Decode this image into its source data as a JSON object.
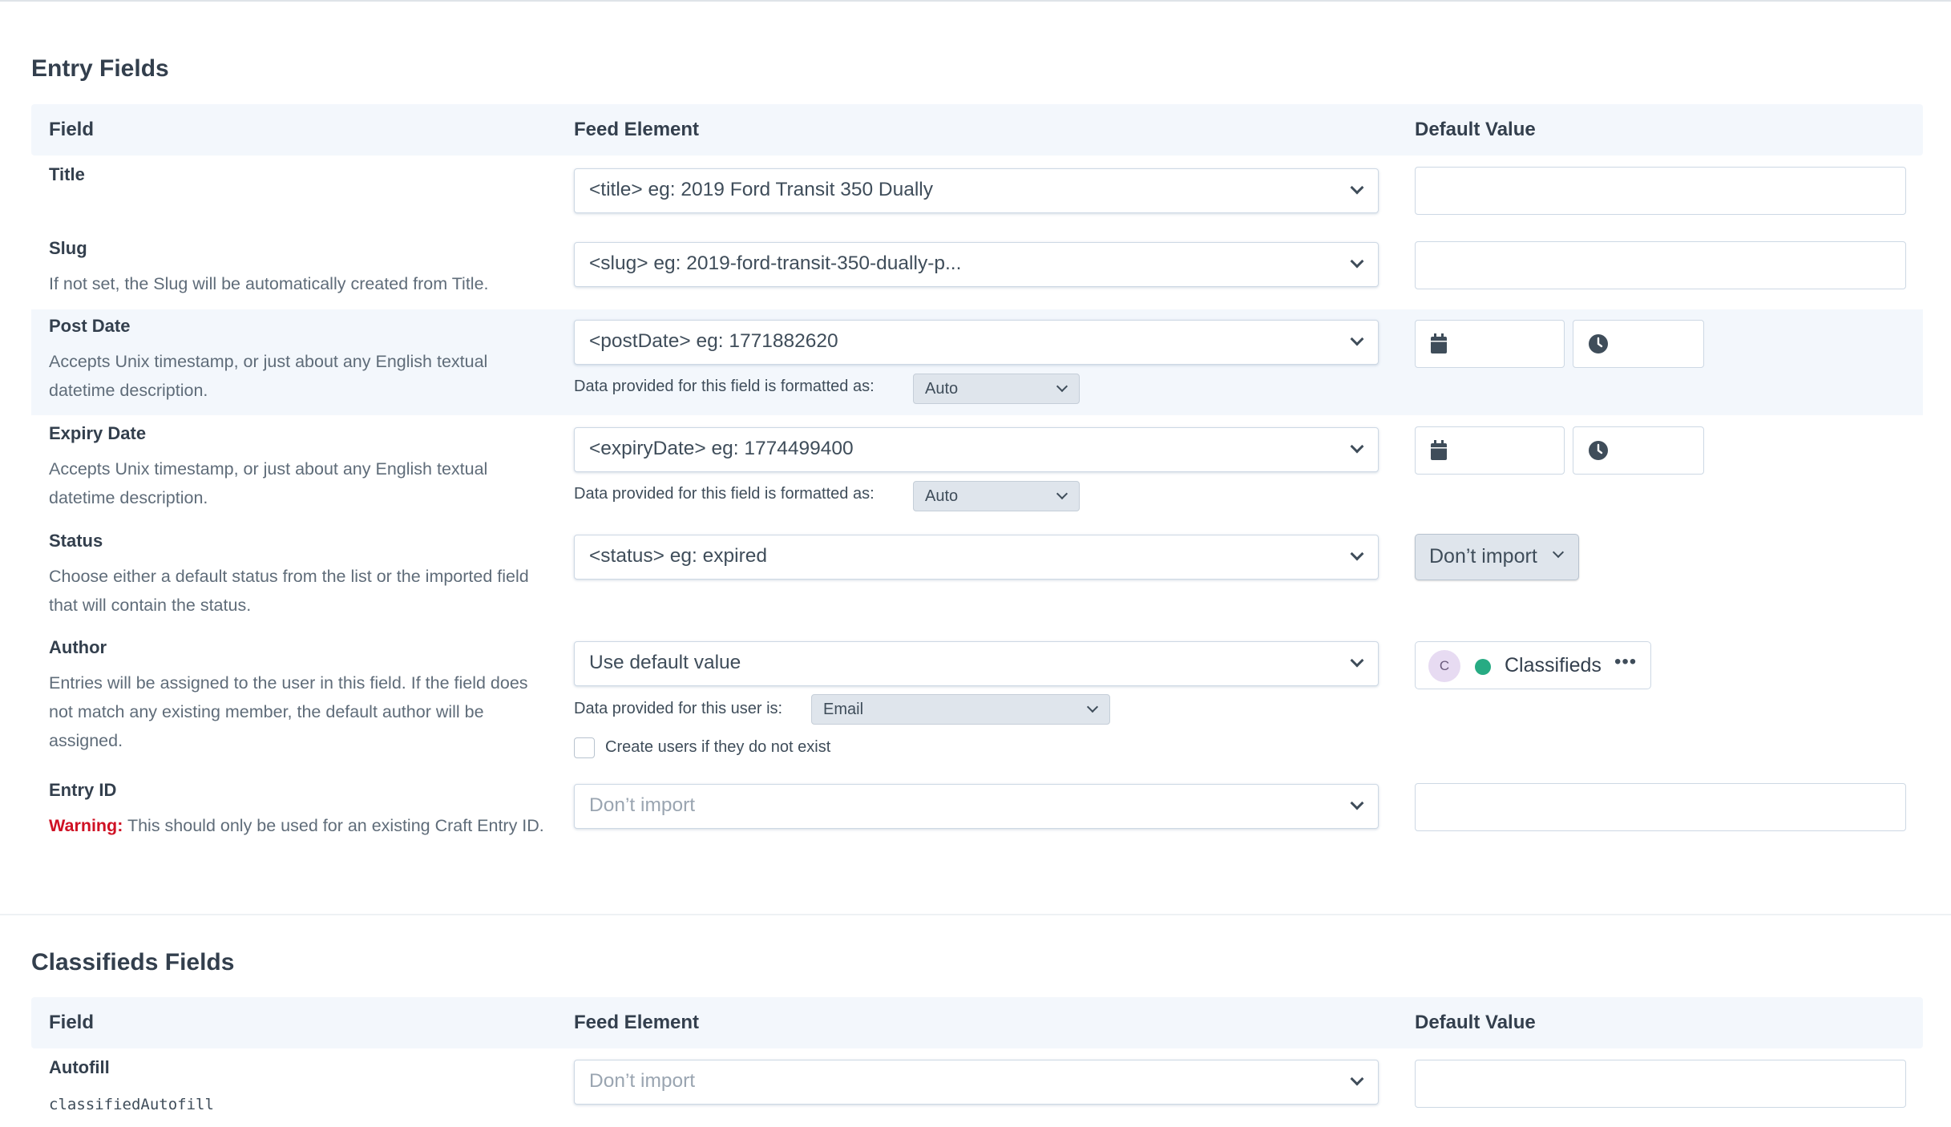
{
  "entry_section": {
    "title": "Entry Fields",
    "headers": {
      "field": "Field",
      "feed_element": "Feed Element",
      "default_value": "Default Value"
    },
    "rows": {
      "title": {
        "name": "Title",
        "feed": "<title> eg: 2019 Ford Transit 350 Dually"
      },
      "slug": {
        "name": "Slug",
        "desc": "If not set, the Slug will be automatically created from Title.",
        "feed": "<slug> eg: 2019-ford-transit-350-dually-p..."
      },
      "post_date": {
        "name": "Post Date",
        "desc": "Accepts Unix timestamp, or just about any English textual datetime description.",
        "feed": "<postDate> eg: 1771882620",
        "format_note": "Data provided for this field is formatted as:",
        "format_value": "Auto"
      },
      "expiry_date": {
        "name": "Expiry Date",
        "desc": "Accepts Unix timestamp, or just about any English textual datetime description.",
        "feed": "<expiryDate> eg: 1774499400",
        "format_note": "Data provided for this field is formatted as:",
        "format_value": "Auto"
      },
      "status": {
        "name": "Status",
        "desc": "Choose either a default status from the list or the imported field that will contain the status.",
        "feed": "<status> eg: expired",
        "default": "Don’t import"
      },
      "author": {
        "name": "Author",
        "desc": "Entries will be assigned to the user in this field. If the field does not match any existing member, the default author will be assigned.",
        "feed": "Use default value",
        "user_note": "Data provided for this user is:",
        "user_format": "Email",
        "create_users_label": "Create users if they do not exist",
        "default_author": {
          "initial": "C",
          "name": "Classifieds"
        }
      },
      "entry_id": {
        "name": "Entry ID",
        "warning_label": "Warning:",
        "desc": "This should only be used for an existing Craft Entry ID.",
        "feed": "Don’t import"
      }
    }
  },
  "classifieds_section": {
    "title": "Classifieds Fields",
    "headers": {
      "field": "Field",
      "feed_element": "Feed Element",
      "default_value": "Default Value"
    },
    "rows": {
      "autofill": {
        "name": "Autofill",
        "handle": "classifiedAutofill",
        "feed": "Don’t import"
      }
    }
  },
  "icons": {
    "calendar": "calendar-icon",
    "clock": "clock-icon",
    "chevron": "chevron-down-icon",
    "more": "more-icon"
  },
  "colors": {
    "status_dot": "#27ab83",
    "warning": "#cf1124",
    "row_highlight": "#f3f7fc"
  }
}
